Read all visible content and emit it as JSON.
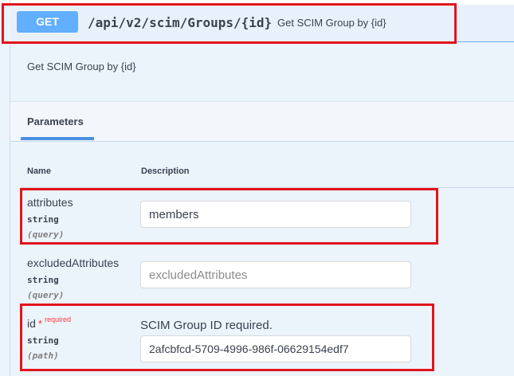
{
  "operation": {
    "method": "GET",
    "path": "/api/v2/scim/Groups/{id}",
    "summary": "Get SCIM Group by {id}",
    "description": "Get SCIM Group by {id}"
  },
  "parameters_section": {
    "tab_label": "Parameters",
    "columns": {
      "name": "Name",
      "description": "Description"
    },
    "params": [
      {
        "name": "attributes",
        "type": "string",
        "in": "(query)",
        "value": "members",
        "placeholder": ""
      },
      {
        "name": "excludedAttributes",
        "type": "string",
        "in": "(query)",
        "value": "",
        "placeholder": "excludedAttributes"
      },
      {
        "name": "id",
        "required_marker": "*",
        "required_text": "required",
        "type": "string",
        "in": "(path)",
        "description": "SCIM Group ID required.",
        "value": "2afcbfcd-5709-4996-986f-06629154edf7",
        "placeholder": ""
      }
    ]
  },
  "colors": {
    "get_badge": "#61affe",
    "highlight": "#e2141c",
    "required": "#ff3b30"
  }
}
